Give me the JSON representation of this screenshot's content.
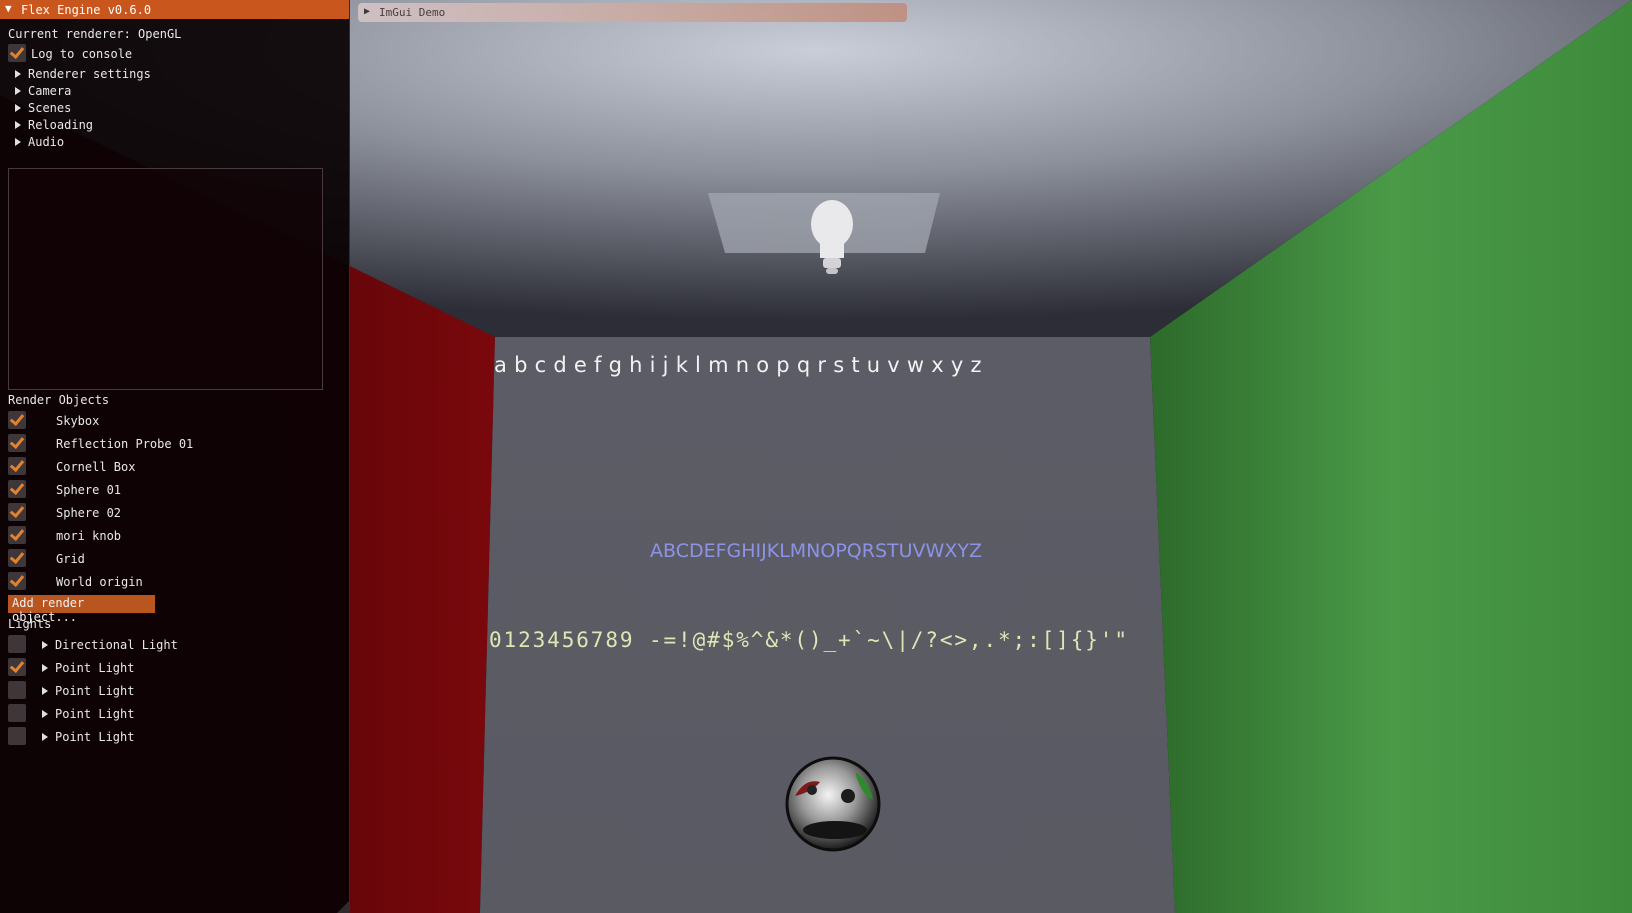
{
  "panel": {
    "title": "Flex Engine v0.6.0",
    "renderer_text": "Current renderer: OpenGL",
    "log_to_console": {
      "label": "Log to console",
      "checked": true
    },
    "sections": [
      "Renderer settings",
      "Camera",
      "Scenes",
      "Reloading",
      "Audio"
    ],
    "render_objects_header": "Render Objects",
    "render_objects": [
      {
        "label": "Skybox",
        "checked": true
      },
      {
        "label": "Reflection Probe 01",
        "checked": true
      },
      {
        "label": "Cornell Box",
        "checked": true
      },
      {
        "label": "Sphere 01",
        "checked": true
      },
      {
        "label": "Sphere 02",
        "checked": true
      },
      {
        "label": "mori knob",
        "checked": true
      },
      {
        "label": "Grid",
        "checked": true
      },
      {
        "label": "World origin",
        "checked": true
      }
    ],
    "add_button": "Add render object...",
    "lights_header": "Lights",
    "lights": [
      {
        "label": "Directional Light",
        "checked": false
      },
      {
        "label": "Point Light",
        "checked": true
      },
      {
        "label": "Point Light",
        "checked": false
      },
      {
        "label": "Point Light",
        "checked": false
      },
      {
        "label": "Point Light",
        "checked": false
      }
    ]
  },
  "imgui_demo": {
    "title": "ImGui Demo"
  },
  "scene": {
    "lowercase_text": "abcdefghijklmnopqrstuvwxyz",
    "uppercase_text": "ABCDEFGHIJKLMNOPQRSTUVWXYZ",
    "symbols_text": "0123456789 -=!@#$%^&*()_+`~\\|/?<>,.*;:[]{}'\""
  },
  "colors": {
    "accent": "#c8561d",
    "checkmark": "#e1822e",
    "wall_left": "#6b0508",
    "wall_right": "#3f8a3d",
    "back_wall": "#5d5d66",
    "ceiling": "#9aa0ad"
  }
}
